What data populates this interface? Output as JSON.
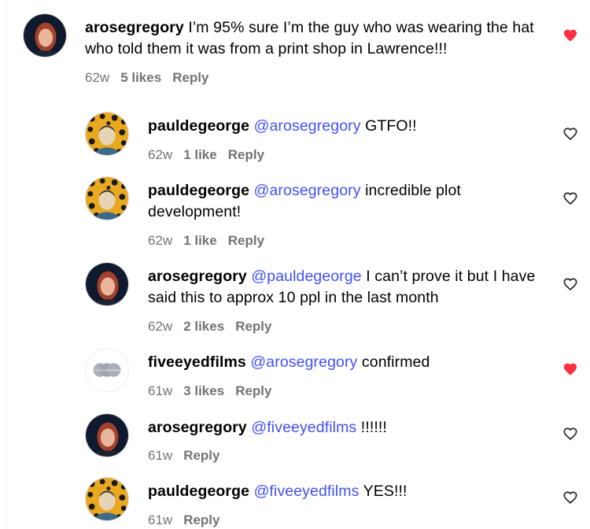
{
  "comments": [
    {
      "username": "arosegregory",
      "mention": "",
      "text": " I’m 95% sure I’m the guy who was wearing the hat who told them it was from a print shop in Lawrence!!!",
      "time": "62w",
      "likes": "5 likes",
      "reply": "Reply",
      "liked": true,
      "avatar": "arosegregory"
    },
    {
      "username": "pauldegeorge",
      "mention": "@arosegregory",
      "text": " GTFO!!",
      "time": "62w",
      "likes": "1 like",
      "reply": "Reply",
      "liked": false,
      "avatar": "pauldegeorge"
    },
    {
      "username": "pauldegeorge",
      "mention": "@arosegregory",
      "text": " incredible plot development!",
      "time": "62w",
      "likes": "1 like",
      "reply": "Reply",
      "liked": false,
      "avatar": "pauldegeorge"
    },
    {
      "username": "arosegregory",
      "mention": "@pauldegeorge",
      "text": " I can’t prove it but I have said this to approx 10 ppl in the last month",
      "time": "62w",
      "likes": "2 likes",
      "reply": "Reply",
      "liked": false,
      "avatar": "arosegregory"
    },
    {
      "username": "fiveeyedfilms",
      "mention": "@arosegregory",
      "text": " confirmed",
      "time": "61w",
      "likes": "3 likes",
      "reply": "Reply",
      "liked": true,
      "avatar": "fiveeyedfilms",
      "avatar_text": "FIVE EYED FILMS"
    },
    {
      "username": "arosegregory",
      "mention": "@fiveeyedfilms",
      "text": " !!!!!!",
      "time": "61w",
      "likes": "",
      "reply": "Reply",
      "liked": false,
      "avatar": "arosegregory"
    },
    {
      "username": "pauldegeorge",
      "mention": "@fiveeyedfilms",
      "text": " YES!!!",
      "time": "61w",
      "likes": "",
      "reply": "Reply",
      "liked": false,
      "avatar": "pauldegeorge"
    }
  ],
  "colors": {
    "liked_heart": "#ff3040",
    "unliked_heart": "#262626",
    "mention": "#4150f7",
    "meta": "#737373"
  }
}
